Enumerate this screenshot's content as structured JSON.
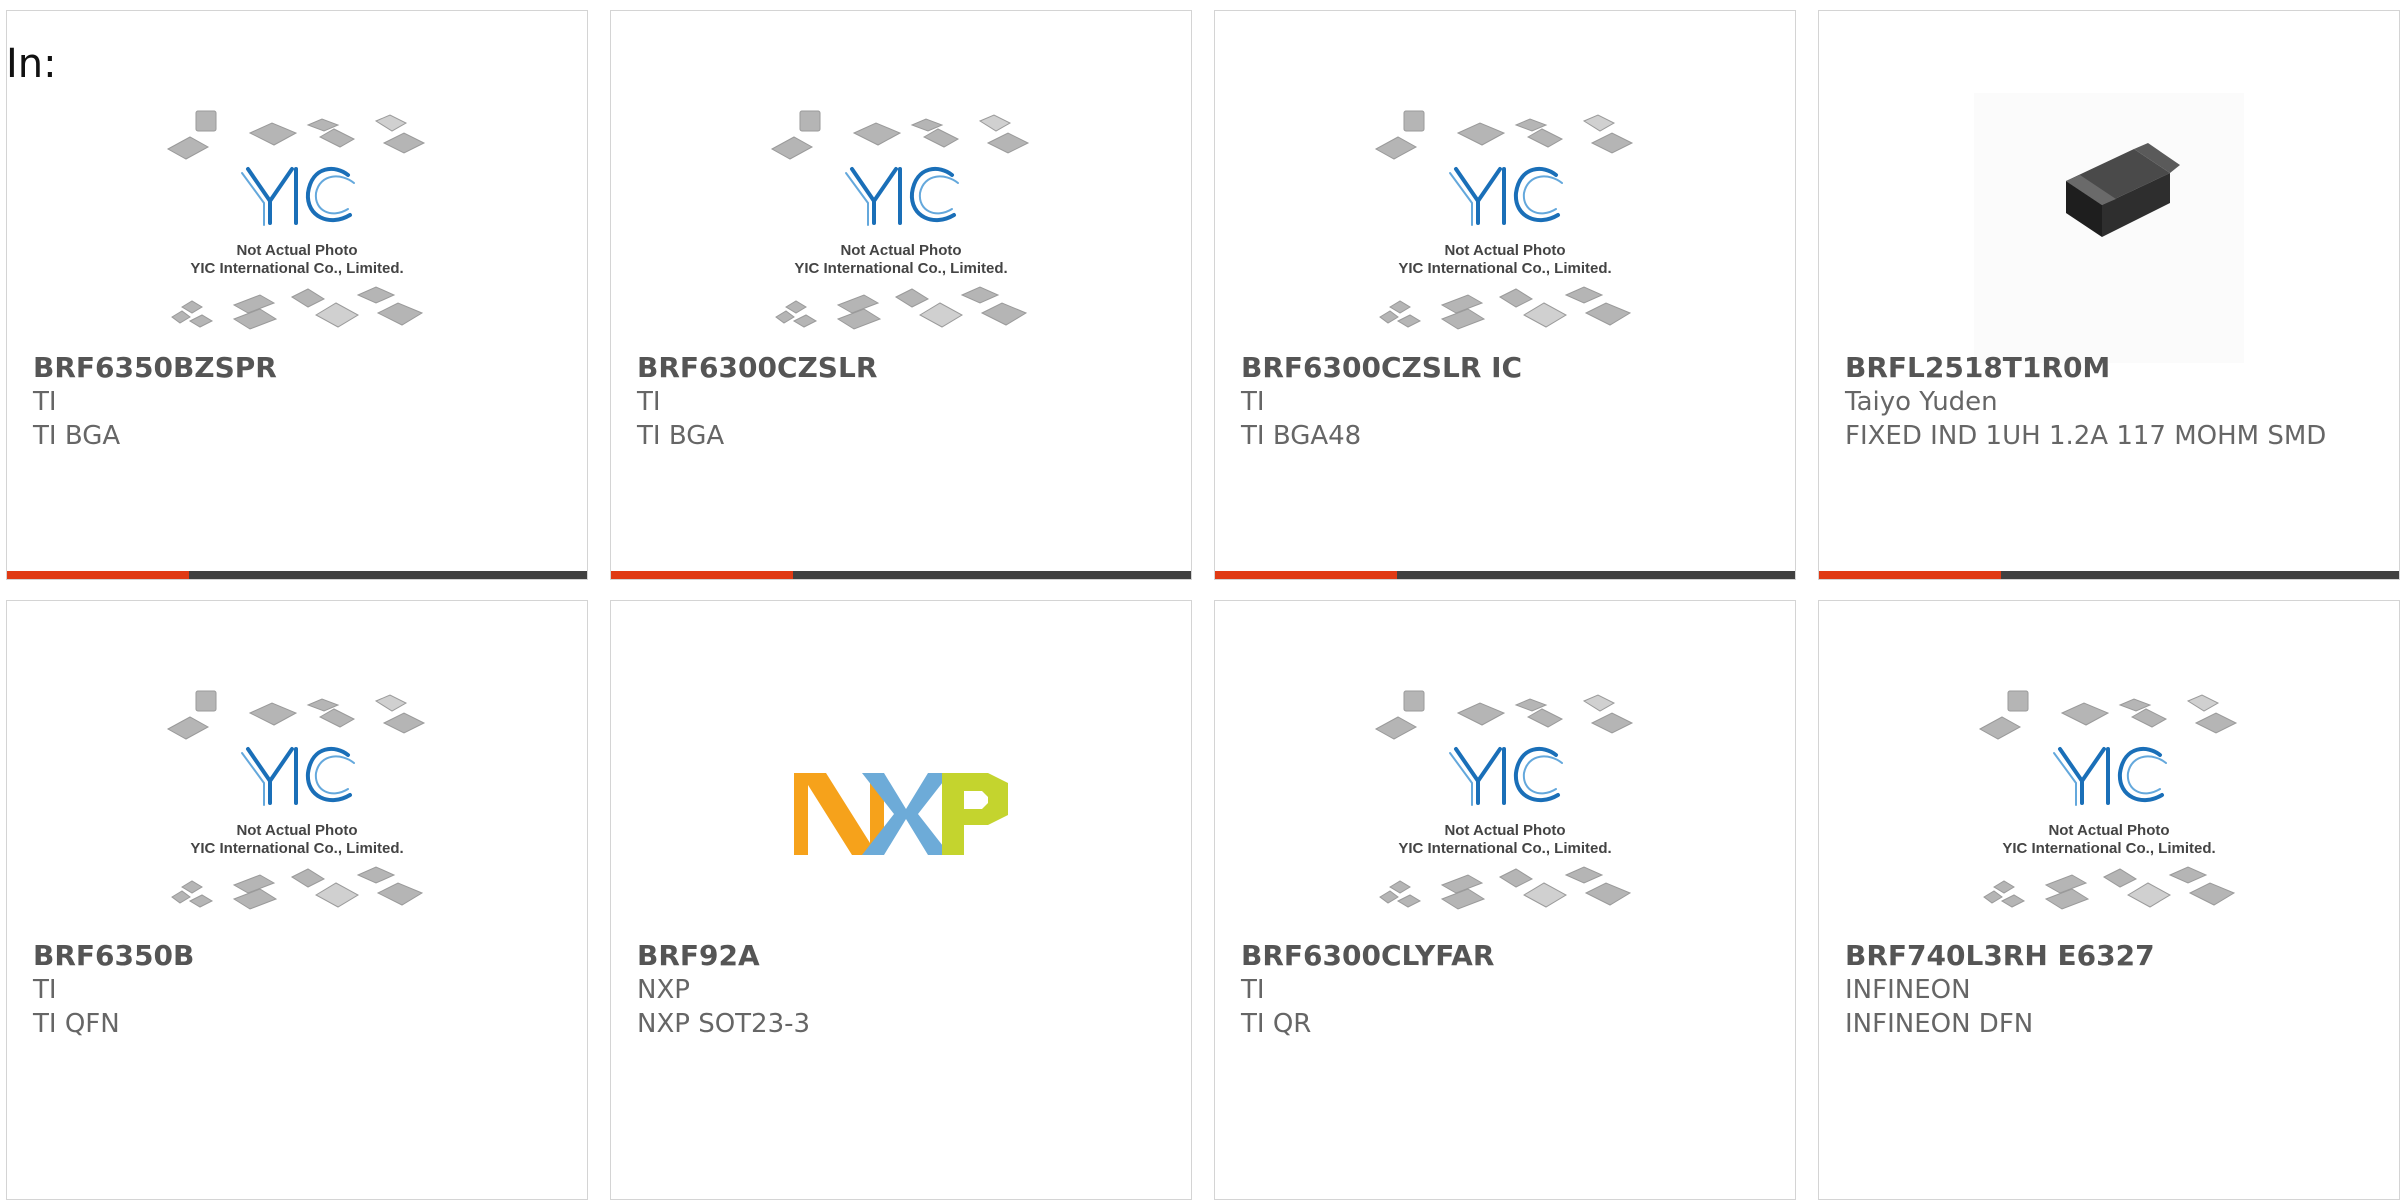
{
  "page": {
    "label": "In:"
  },
  "placeholder": {
    "line1": "Not Actual Photo",
    "line2": "YIC International Co., Limited."
  },
  "colors": {
    "accent": "#e03a14",
    "bar": "#404040",
    "border": "#d4d4d4",
    "brand_blue": "#1a6fb8"
  },
  "products": [
    {
      "part_number": "BRF6350BZSPR",
      "manufacturer": "TI",
      "description": "TI BGA",
      "image": "yic-placeholder-icon"
    },
    {
      "part_number": "BRF6300CZSLR",
      "manufacturer": "TI",
      "description": "TI BGA",
      "image": "yic-placeholder-icon"
    },
    {
      "part_number": "BRF6300CZSLR IC",
      "manufacturer": "TI",
      "description": "TI BGA48",
      "image": "yic-placeholder-icon"
    },
    {
      "part_number": "BRFL2518T1R0M",
      "manufacturer": "Taiyo Yuden",
      "description": "FIXED IND 1UH 1.2A 117 MOHM SMD",
      "image": "inductor-chip-photo"
    },
    {
      "part_number": "BRF6350B",
      "manufacturer": "TI",
      "description": "TI QFN",
      "image": "yic-placeholder-icon"
    },
    {
      "part_number": "BRF92A",
      "manufacturer": "NXP",
      "description": "NXP SOT23-3",
      "image": "nxp-logo"
    },
    {
      "part_number": "BRF6300CLYFAR",
      "manufacturer": "TI",
      "description": "TI QR",
      "image": "yic-placeholder-icon"
    },
    {
      "part_number": "BRF740L3RH E6327",
      "manufacturer": "INFINEON",
      "description": "INFINEON DFN",
      "image": "yic-placeholder-icon"
    }
  ],
  "logos": {
    "nxp": {
      "text": "NXP"
    },
    "yic": {
      "text": "YIC"
    }
  }
}
